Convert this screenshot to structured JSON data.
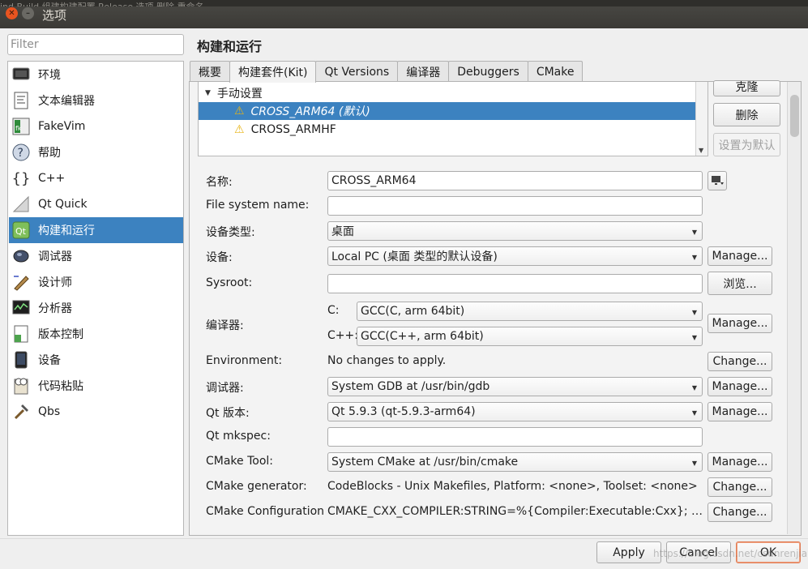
{
  "window": {
    "title": "选项",
    "background_strip": "ind Build        组建构建配置    Release        选项                    删除          重命名"
  },
  "filter": {
    "placeholder": "Filter"
  },
  "sidebar": {
    "items": [
      {
        "label": "环境",
        "icon": "monitor-icon"
      },
      {
        "label": "文本编辑器",
        "icon": "text-editor-icon"
      },
      {
        "label": "FakeVim",
        "icon": "fakevim-icon"
      },
      {
        "label": "帮助",
        "icon": "help-icon"
      },
      {
        "label": "C++",
        "icon": "braces-icon"
      },
      {
        "label": "Qt Quick",
        "icon": "qt-quick-icon"
      },
      {
        "label": "构建和运行",
        "icon": "qt-build-icon",
        "selected": true
      },
      {
        "label": "调试器",
        "icon": "bug-icon"
      },
      {
        "label": "设计师",
        "icon": "designer-icon"
      },
      {
        "label": "分析器",
        "icon": "analyzer-icon"
      },
      {
        "label": "版本控制",
        "icon": "version-control-icon"
      },
      {
        "label": "设备",
        "icon": "device-icon"
      },
      {
        "label": "代码粘贴",
        "icon": "code-paste-icon"
      },
      {
        "label": "Qbs",
        "icon": "hammer-icon"
      }
    ]
  },
  "page_title": "构建和运行",
  "tabs": [
    {
      "label": "概要"
    },
    {
      "label": "构建套件(Kit)",
      "active": true
    },
    {
      "label": "Qt Versions"
    },
    {
      "label": "编译器"
    },
    {
      "label": "Debuggers"
    },
    {
      "label": "CMake"
    }
  ],
  "kit_tree": {
    "group_label": "手动设置",
    "kits": [
      {
        "label": "CROSS_ARM64 (默认)",
        "selected": true
      },
      {
        "label": "CROSS_ARMHF"
      }
    ]
  },
  "kit_buttons": {
    "clone": "克隆",
    "delete": "删除",
    "make_default": "设置为默认"
  },
  "form": {
    "name_label": "名称:",
    "name_value": "CROSS_ARM64",
    "fs_name_label": "File system name:",
    "fs_name_value": "",
    "device_type_label": "设备类型:",
    "device_type_value": "桌面",
    "device_label": "设备:",
    "device_value": "Local PC (桌面 类型的默认设备)",
    "sysroot_label": "Sysroot:",
    "sysroot_value": "",
    "compiler_label": "编译器:",
    "c_label": "C:",
    "c_value": "GCC(C, arm 64bit)",
    "cxx_label": "C++:",
    "cxx_value": "GCC(C++, arm 64bit)",
    "env_label": "Environment:",
    "env_value": "No changes to apply.",
    "debugger_label": "调试器:",
    "debugger_value": "System GDB at /usr/bin/gdb",
    "qt_version_label": "Qt 版本:",
    "qt_version_value": "Qt 5.9.3 (qt-5.9.3-arm64)",
    "qt_mkspec_label": "Qt mkspec:",
    "qt_mkspec_value": "",
    "cmake_tool_label": "CMake Tool:",
    "cmake_tool_value": "System CMake at /usr/bin/cmake",
    "cmake_gen_label": "CMake generator:",
    "cmake_gen_value": "CodeBlocks - Unix Makefiles, Platform: <none>, Toolset: <none>",
    "cmake_conf_label": "CMake Configuration",
    "cmake_conf_value": "CMAKE_CXX_COMPILER:STRING=%{Compiler:Executable:Cxx}; C..."
  },
  "buttons": {
    "manage": "Manage...",
    "browse": "浏览...",
    "change": "Change...",
    "apply": "Apply",
    "cancel": "Cancel",
    "ok": "OK"
  },
  "watermark": "https://blog.csdn.net/csdnrenjian"
}
